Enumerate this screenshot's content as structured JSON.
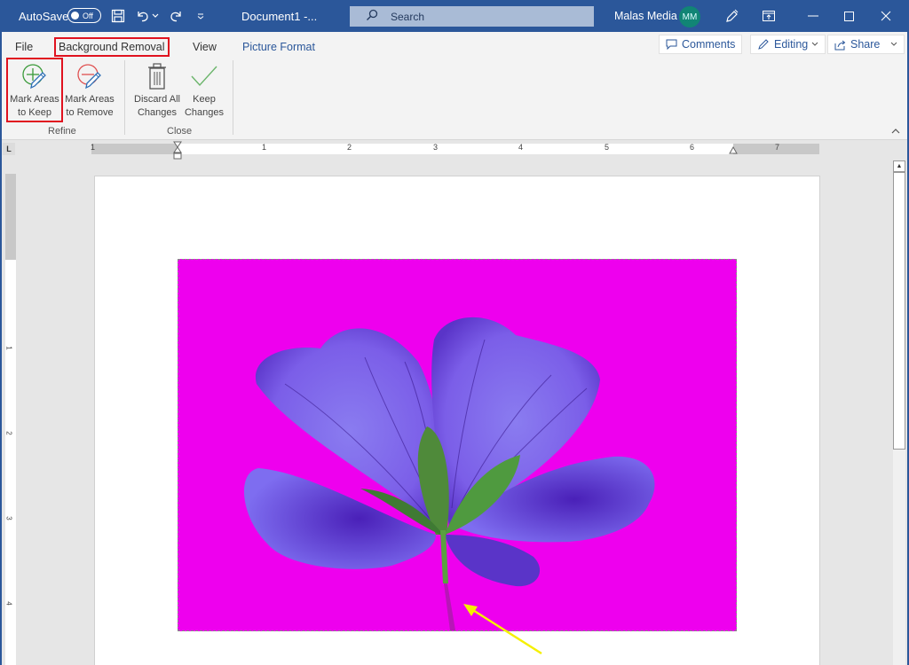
{
  "titlebar": {
    "autosave_label": "AutoSave",
    "autosave_state": "Off",
    "document_title": "Document1 -...",
    "search_placeholder": "Search",
    "user_name": "Malas Media",
    "user_initials": "MM",
    "accent_color": "#2b579a"
  },
  "ribbon": {
    "tabs": [
      {
        "label": "File"
      },
      {
        "label": "Background Removal",
        "active": true
      },
      {
        "label": "View"
      },
      {
        "label": "Picture Format"
      }
    ],
    "right_buttons": {
      "comments": "Comments",
      "editing": "Editing",
      "share": "Share"
    },
    "groups": [
      {
        "label": "Refine",
        "buttons": [
          {
            "line1": "Mark Areas",
            "line2": "to Keep",
            "icon": "mark-keep-icon",
            "highlighted": true
          },
          {
            "line1": "Mark Areas",
            "line2": "to Remove",
            "icon": "mark-remove-icon"
          }
        ]
      },
      {
        "label": "Close",
        "buttons": [
          {
            "line1": "Discard All",
            "line2": "Changes",
            "icon": "trash-icon"
          },
          {
            "line1": "Keep",
            "line2": "Changes",
            "icon": "checkmark-icon"
          }
        ]
      }
    ]
  },
  "ruler": {
    "horizontal_labels": [
      "1",
      "1",
      "2",
      "3",
      "4",
      "5",
      "6",
      "7"
    ],
    "vertical_labels": [
      "1",
      "2",
      "3",
      "4"
    ]
  },
  "document": {
    "picture_removal_color": "#ee00ee",
    "annotation_arrow_color": "#f5f000"
  }
}
